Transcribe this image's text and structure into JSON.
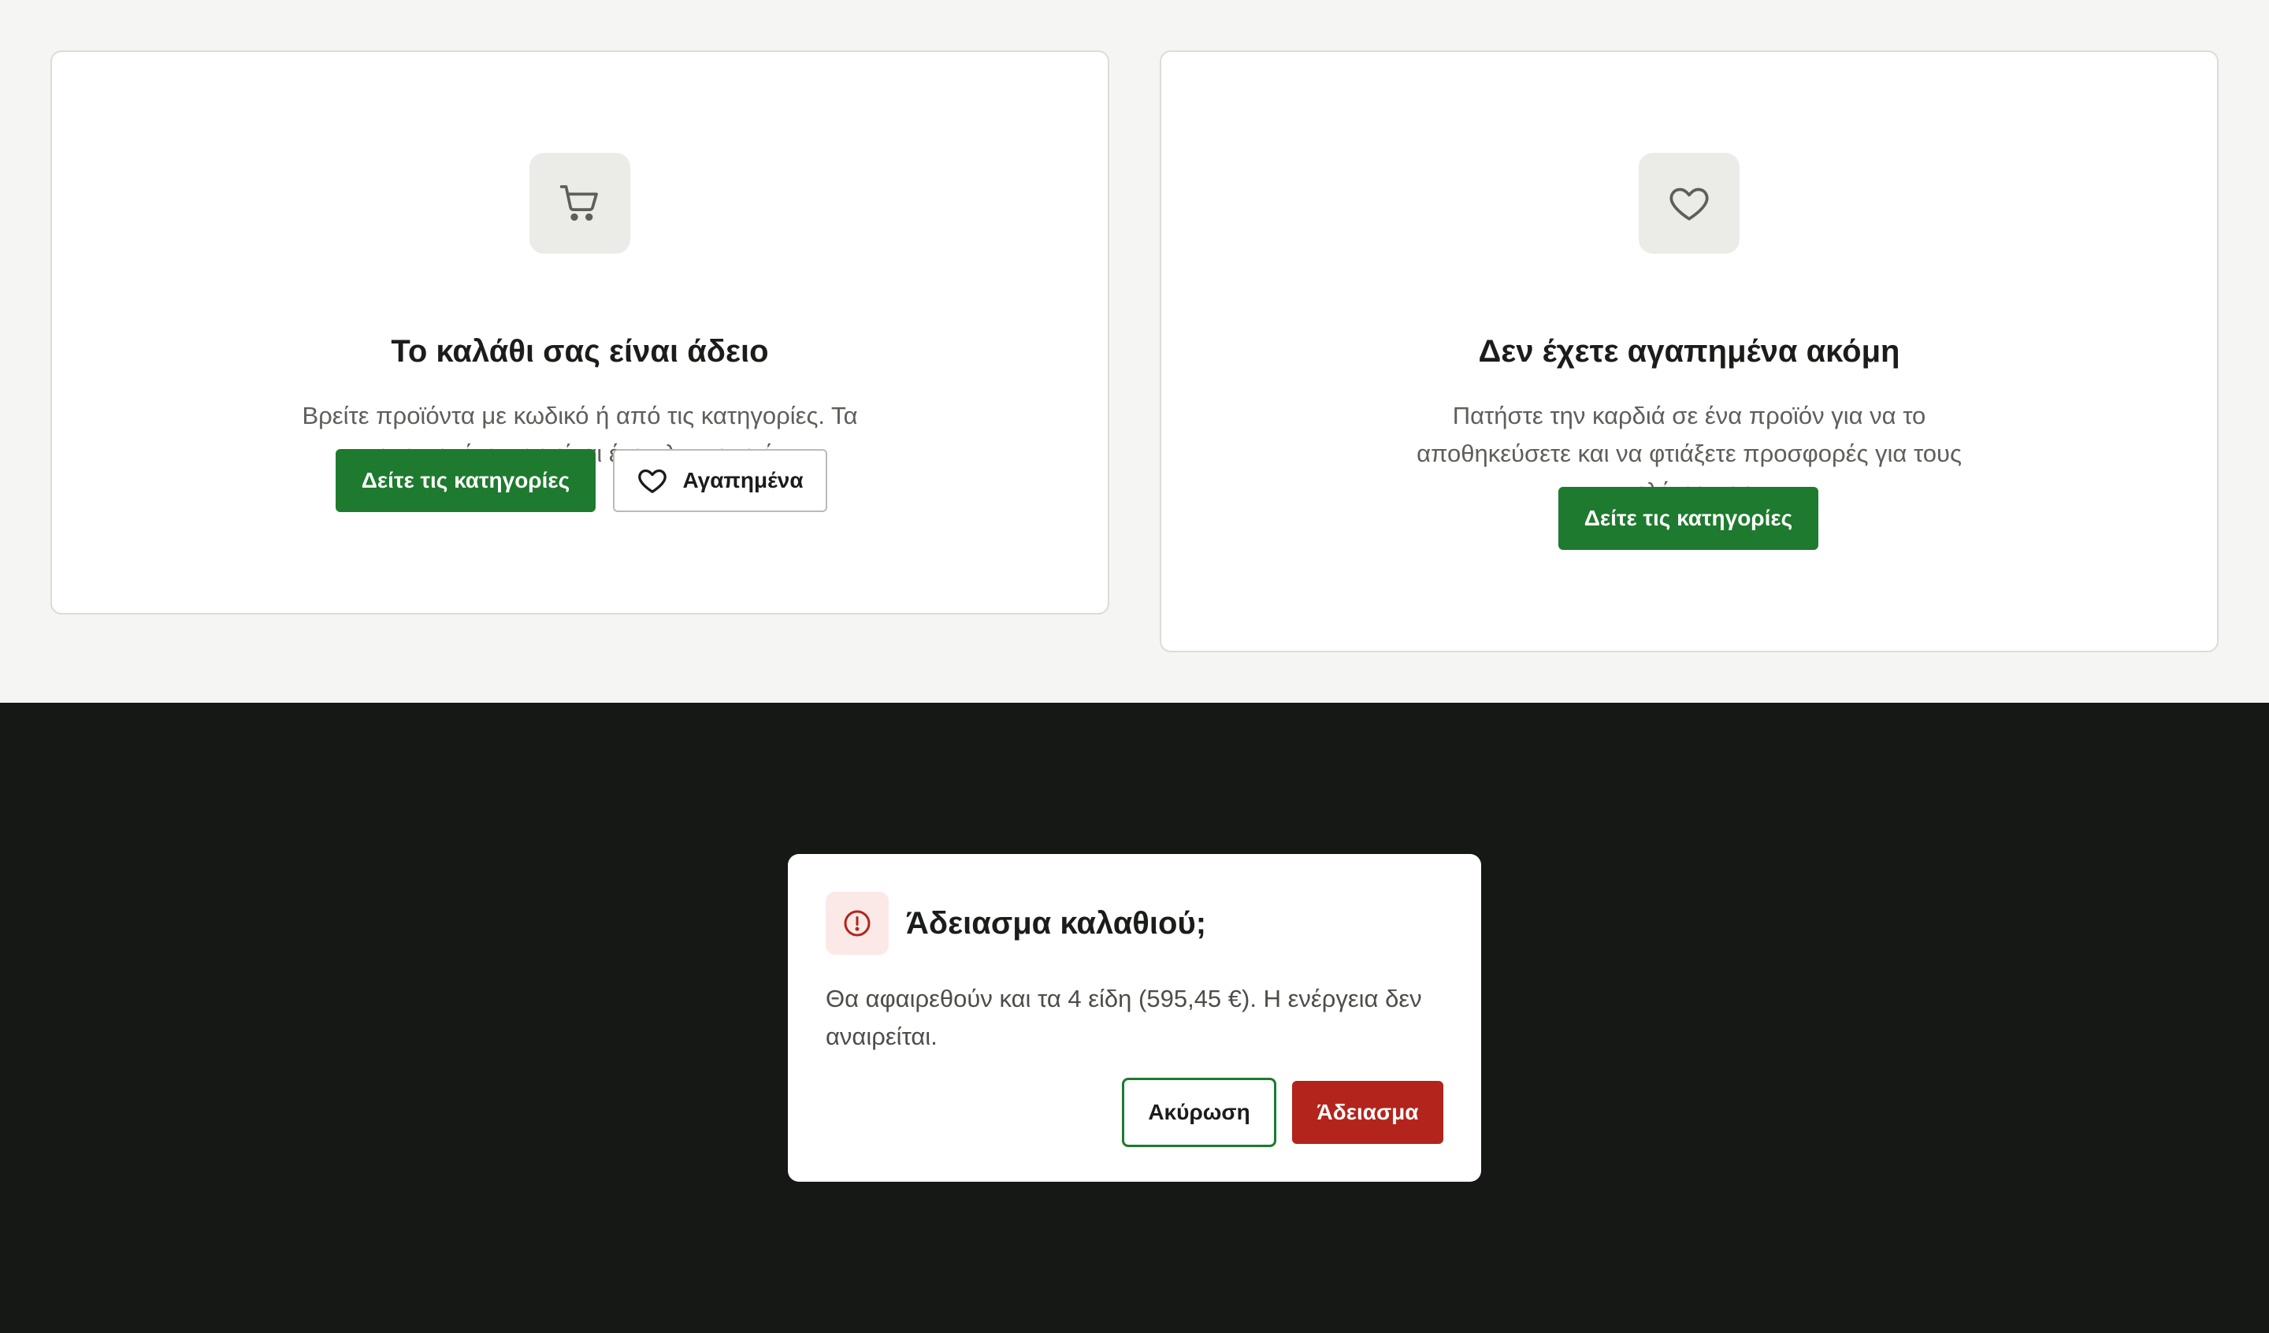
{
  "empty_cart_card": {
    "icon": "cart-icon",
    "title": "Το καλάθι σας είναι άδειο",
    "text": "Βρείτε προϊόντα με κωδικό ή από τις κατηγορίες. Τα αγαπημένα σας είναι ένα κλικ μακριά.",
    "primary_button": "Δείτε τις κατηγορίες",
    "secondary_button": "Αγαπημένα",
    "secondary_icon": "heart-icon"
  },
  "empty_favorites_card": {
    "icon": "heart-icon",
    "title": "Δεν έχετε αγαπημένα ακόμη",
    "text": "Πατήστε την καρδιά σε ένα προϊόν για να το αποθηκεύσετε και να φτιάξετε προσφορές για τους πελάτες σας.",
    "primary_button": "Δείτε τις κατηγορίες"
  },
  "confirm_dialog": {
    "icon": "alert-circle-icon",
    "title": "Άδειασμα καλαθιού;",
    "text": "Θα αφαιρεθούν και τα 4 είδη (595,45 €). Η ενέργεια δεν αναιρείται.",
    "cancel_button": "Ακύρωση",
    "confirm_button": "Άδειασμα"
  },
  "colors": {
    "accent_green": "#1e7a2e",
    "danger_red": "#b3241c",
    "overlay": "#161815",
    "page_bg": "#f5f5f3"
  }
}
